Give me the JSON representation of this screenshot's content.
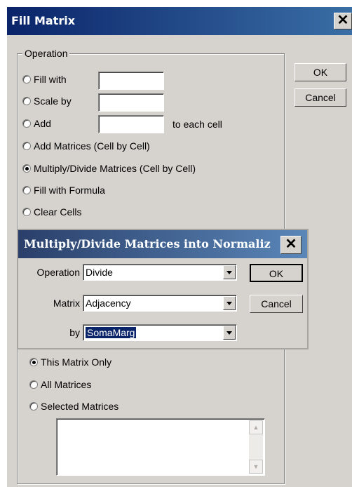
{
  "main_dialog": {
    "title": "Fill Matrix",
    "close_glyph": "✕",
    "operation_group_label": "Operation",
    "options": [
      {
        "label": "Fill with",
        "selected": false
      },
      {
        "label": "Scale by",
        "selected": false
      },
      {
        "label": "Add",
        "selected": false,
        "suffix": "to each cell"
      },
      {
        "label": "Add Matrices (Cell by Cell)",
        "selected": false
      },
      {
        "label": "Multiply/Divide Matrices (Cell by Cell)",
        "selected": true
      },
      {
        "label": "Fill with Formula",
        "selected": false
      },
      {
        "label": "Clear Cells",
        "selected": false
      }
    ],
    "ok_label": "OK",
    "cancel_label": "Cancel",
    "scope_options": [
      {
        "label": "This Matrix Only",
        "selected": true
      },
      {
        "label": "All Matrices",
        "selected": false
      },
      {
        "label": "Selected Matrices",
        "selected": false
      }
    ]
  },
  "sub_dialog": {
    "title": "Multiply/Divide Matrices into Normaliz",
    "close_glyph": "✕",
    "operation_label": "Operation",
    "operation_value": "Divide",
    "matrix_label": "Matrix",
    "matrix_value": "Adjacency",
    "by_label": "by",
    "by_value": "SomaMarg",
    "ok_label": "OK",
    "cancel_label": "Cancel"
  },
  "icons": {
    "scroll_up": "▲",
    "scroll_down": "▼"
  }
}
